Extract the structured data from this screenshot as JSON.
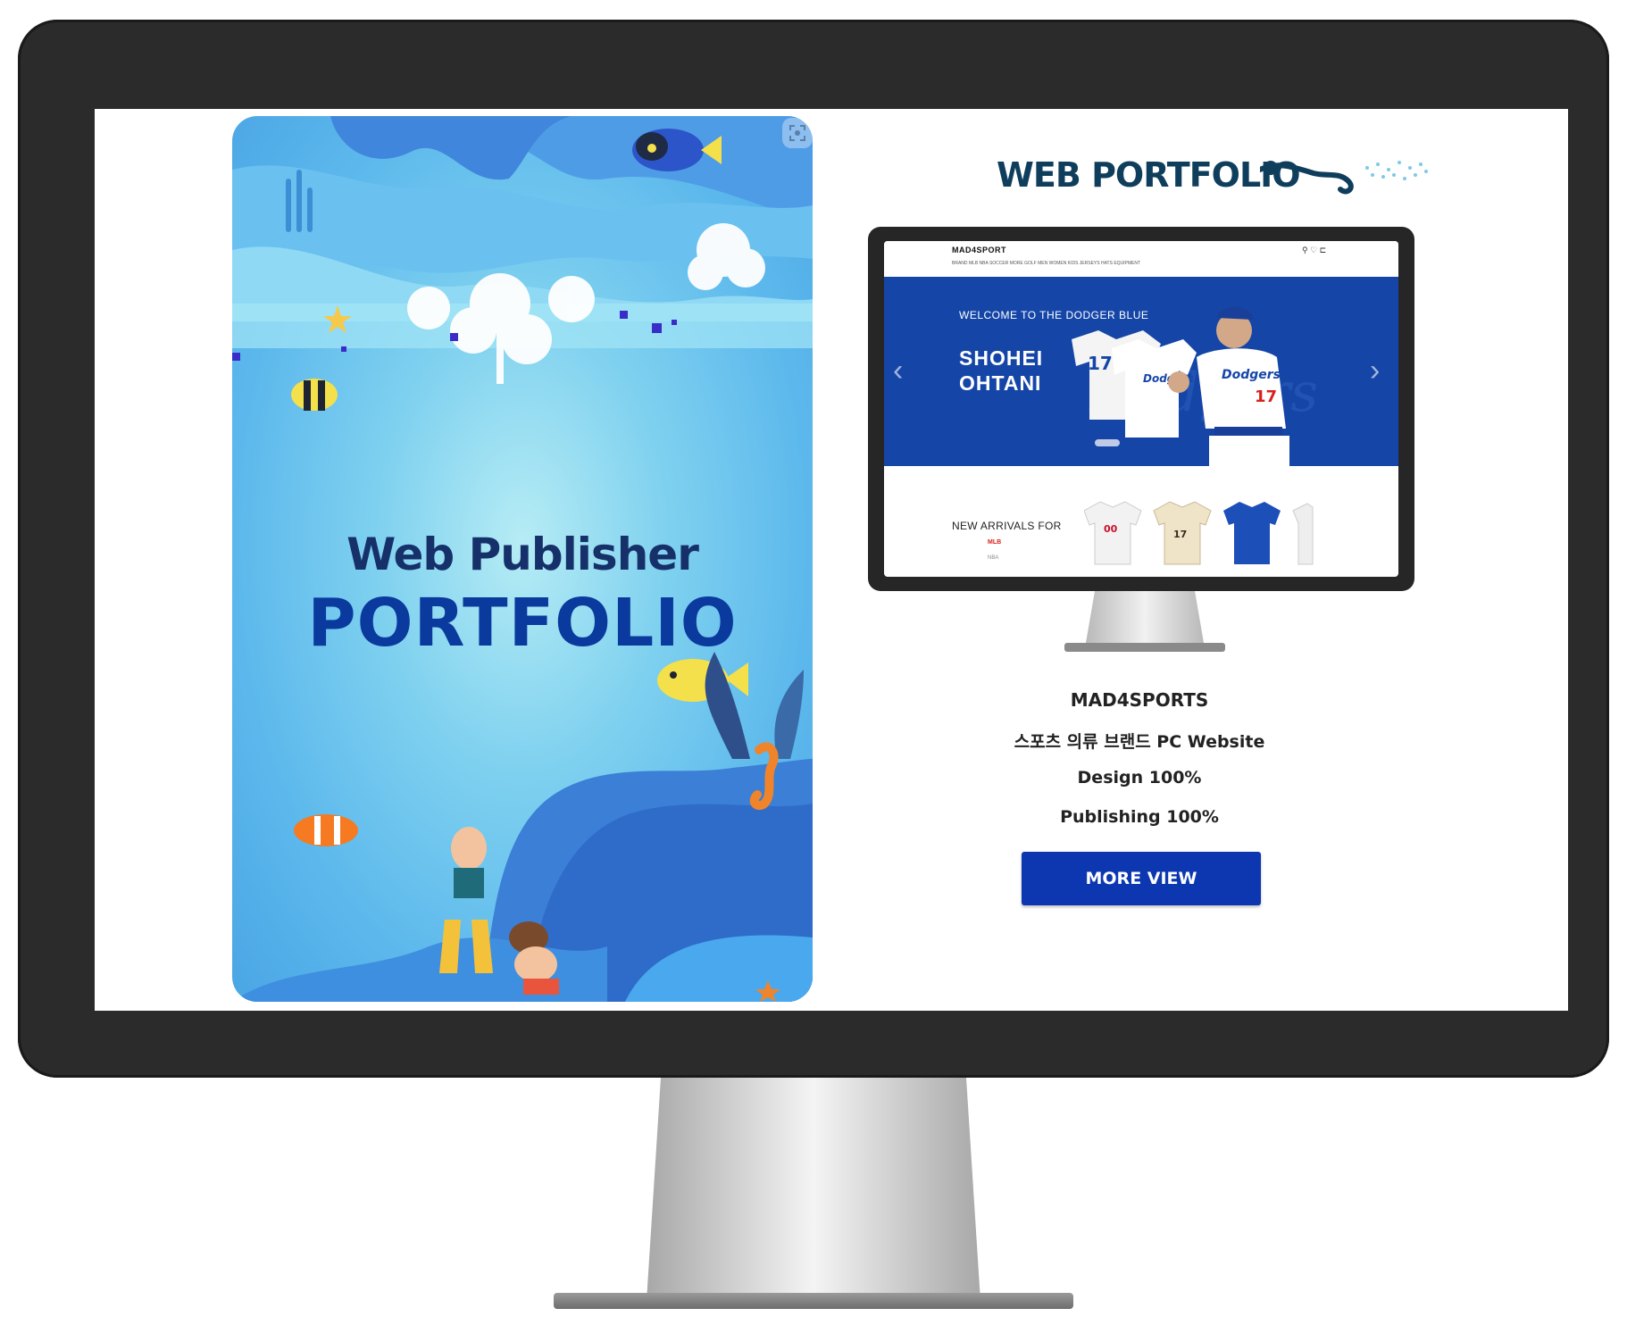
{
  "ocean_card": {
    "title_line1": "Web Publisher",
    "title_line2": "PORTFOLIO"
  },
  "right_panel": {
    "heading": "WEB PORTFOLIO",
    "mini_site": {
      "logo": "MAD4SPORT",
      "nav": "BRAND MLB NBA SOCCER MORE GOLF MEN WOMEN KIDS JERSEYS HATS EQUIPMENT",
      "header_icons": "⚲ ♡ ⊏",
      "hero_welcome": "WELCOME TO THE DODGER BLUE",
      "hero_name_line1": "SHOHEI",
      "hero_name_line2": "OHTANI",
      "arrivals_label": "NEW ARRIVALS FOR",
      "arrivals_tab_active": "MLB",
      "arrivals_tab_other": "NBA",
      "jersey_numbers": [
        "17",
        "17",
        "00",
        "17"
      ]
    },
    "project_name": "MAD4SPORTS",
    "project_desc": "스포츠 의류 브랜드 PC Website",
    "design": "Design 100%",
    "publishing": "Publishing 100%",
    "more_button": "MORE VIEW"
  },
  "colors": {
    "monitor_frame": "#2b2b2b",
    "hero_blue": "#1546a7",
    "button_blue": "#0c37b0",
    "title_navy": "#0f3e5c"
  },
  "icons": [
    "scan-icon",
    "diver-icon",
    "chevron-left-icon",
    "chevron-right-icon",
    "search-icon",
    "heart-icon",
    "cart-icon"
  ]
}
